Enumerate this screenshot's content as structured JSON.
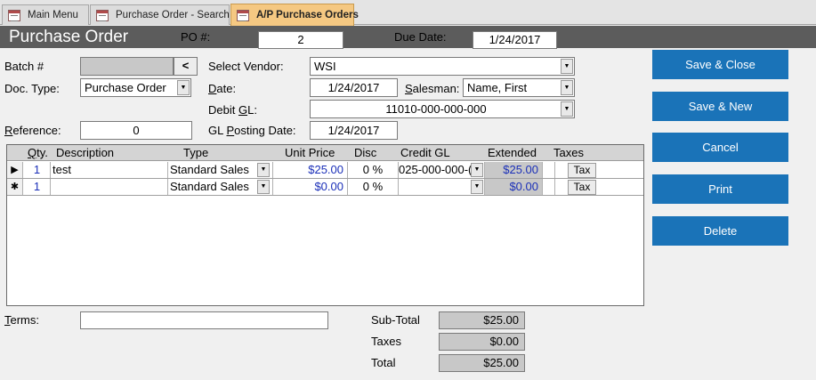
{
  "tabs": [
    {
      "label": "Main Menu",
      "active": false
    },
    {
      "label": "Purchase Order - Search",
      "active": false
    },
    {
      "label": "A/P Purchase Orders",
      "active": true
    }
  ],
  "header": {
    "title": "Purchase Order",
    "po_label": "PO #:",
    "po_value": "2",
    "due_label": "Due Date:",
    "due_value": "1/24/2017"
  },
  "form": {
    "batch_label": "Batch #",
    "batch_value": "",
    "batch_btn": "<",
    "doctype_label": "Doc. Type:",
    "doctype_value": "Purchase Order",
    "reference_label": "Reference:",
    "reference_value": "0",
    "vendor_label": "Select Vendor:",
    "vendor_value": "WSI",
    "date_label": "Date:",
    "date_value": "1/24/2017",
    "salesman_label": "Salesman:",
    "salesman_value": "Name, First",
    "debitgl_label": "Debit GL:",
    "debitgl_value": "11010-000-000-000",
    "glposting_label": "GL Posting Date:",
    "glposting_value": "1/24/2017"
  },
  "grid": {
    "columns": [
      "Qty.",
      "Description",
      "Type",
      "Unit Price",
      "Disc",
      "Credit GL",
      "Extended",
      "Taxes"
    ],
    "rows": [
      {
        "selector": "▶",
        "qty": "1",
        "description": "test",
        "type": "Standard Sales",
        "unit_price": "$25.00",
        "disc": "0 %",
        "credit_gl": "025-000-000-(",
        "extended": "$25.00",
        "tax_btn": "Tax"
      },
      {
        "selector": "✱",
        "qty": "1",
        "description": "",
        "type": "Standard Sales",
        "unit_price": "$0.00",
        "disc": "0 %",
        "credit_gl": "",
        "extended": "$0.00",
        "tax_btn": "Tax"
      }
    ]
  },
  "footer": {
    "terms_label": "Terms:",
    "terms_value": "",
    "subtotal_label": "Sub-Total",
    "subtotal_value": "$25.00",
    "taxes_label": "Taxes",
    "taxes_value": "$0.00",
    "total_label": "Total",
    "total_value": "$25.00"
  },
  "actions": {
    "save_close": "Save & Close",
    "save_new": "Save & New",
    "cancel": "Cancel",
    "print": "Print",
    "delete": "Delete"
  },
  "colors": {
    "accent_button": "#1a73b8",
    "header_band": "#5c5c5c",
    "active_tab": "#f5c882",
    "link_blue": "#1a2fb8"
  },
  "icons": {
    "tab_icon": "form-icon",
    "dropdown": "chevron-down-icon",
    "record_current": "record-selector-icon",
    "record_new": "new-record-icon"
  }
}
